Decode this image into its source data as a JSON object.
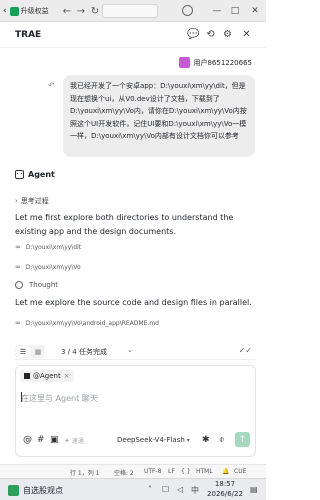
{
  "window": {
    "upgrade_label": "升级权益",
    "nav_back": "←",
    "nav_forward": "→",
    "nav_refresh": "↻",
    "minimize": "—",
    "maximize": "□",
    "close": "✕"
  },
  "header": {
    "title": "TRAE"
  },
  "user_message": {
    "user_name": "用户8651220665",
    "text": "我已经开发了一个安卓app：D:\\youxi\\xm\\yy\\dit，但是现在想换个ui，从V0.dev设计了文档，下载到了D:\\youxi\\xm\\yy\\Vo内，请你在D:\\youxi\\xm\\yy\\Vo内按照这个UI开发软件，记住UI要和D:\\youxi\\xm\\yy\\Vo一模一样，D:\\youxi\\xm\\yy\\Vo内部有设计文档你可以参考"
  },
  "agent": {
    "label": "Agent",
    "think_label": "思考过程",
    "para1": "Let me first explore both directories to understand the existing app and the design documents.",
    "tool1": "D:\\youxi\\xm\\yy\\dit",
    "tool2": "D:\\youxi\\xm\\yy\\Vo",
    "thought_label": "Thought",
    "para2": "Let me explore the source code and design files in parallel.",
    "tool3": "D:\\youxi\\xm\\yy\\Vo\\android_app\\README.md"
  },
  "tasks": {
    "status": "3 / 4 任务完成"
  },
  "composer": {
    "mention_label": "@Agent",
    "placeholder": "在这里与 Agent 聊天",
    "optimize_label": "速通",
    "model_name": "DeepSeek-V4-Flash"
  },
  "statusbar": {
    "position": "行 1，列 1",
    "spaces": "空格: 2",
    "encoding": "UTF-8",
    "eol": "LF",
    "braces": "{ }",
    "language": "HTML",
    "ime": "CUE"
  },
  "taskbar": {
    "news_label": "自选股观点",
    "time": "18:57",
    "date": "2026/6/22"
  },
  "colors": {
    "accent": "#18a058",
    "send_button": "#a8d8c0",
    "bubble": "#ededed",
    "avatar": "#c25cd6"
  }
}
